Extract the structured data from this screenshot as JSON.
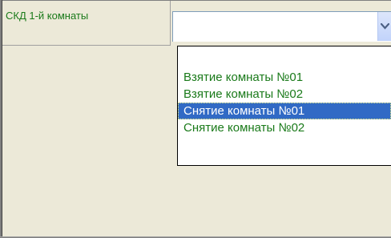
{
  "row": {
    "label": "СКД 1-й комнаты",
    "value": ""
  },
  "dropdown": {
    "options": [
      "",
      "Взятие комнаты №01",
      "Взятие комнаты №02",
      "Снятие комнаты №01",
      "Снятие комнаты №02"
    ],
    "highlighted_index": 3
  },
  "colors": {
    "option_text": "#1a7a1a",
    "highlight": "#316ac5",
    "background": "#ece9d8"
  },
  "icons": {
    "dropdown_button": "chevron-down-icon"
  }
}
